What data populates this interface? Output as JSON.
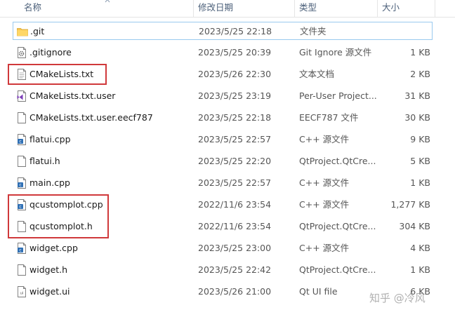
{
  "header": {
    "name": "名称",
    "date_modified": "修改日期",
    "type": "类型",
    "size": "大小"
  },
  "files": [
    {
      "name": ".git",
      "date": "2023/5/25 22:18",
      "type": "文件夹",
      "size": "",
      "icon": "folder-icon"
    },
    {
      "name": ".gitignore",
      "date": "2023/5/25 20:39",
      "type": "Git Ignore 源文件",
      "size": "1 KB",
      "icon": "gear-file-icon"
    },
    {
      "name": "CMakeLists.txt",
      "date": "2023/5/26 22:30",
      "type": "文本文档",
      "size": "2 KB",
      "icon": "text-file-icon"
    },
    {
      "name": "CMakeLists.txt.user",
      "date": "2023/5/25 23:19",
      "type": "Per-User Project...",
      "size": "31 KB",
      "icon": "visual-studio-file-icon"
    },
    {
      "name": "CMakeLists.txt.user.eecf787",
      "date": "2023/5/25 22:18",
      "type": "EECF787 文件",
      "size": "30 KB",
      "icon": "blank-file-icon"
    },
    {
      "name": "flatui.cpp",
      "date": "2023/5/25 22:57",
      "type": "C++ 源文件",
      "size": "9 KB",
      "icon": "cpp-file-icon"
    },
    {
      "name": "flatui.h",
      "date": "2023/5/25 22:20",
      "type": "QtProject.QtCre...",
      "size": "5 KB",
      "icon": "blank-file-icon"
    },
    {
      "name": "main.cpp",
      "date": "2023/5/25 22:57",
      "type": "C++ 源文件",
      "size": "1 KB",
      "icon": "cpp-file-icon"
    },
    {
      "name": "qcustomplot.cpp",
      "date": "2022/11/6 23:54",
      "type": "C++ 源文件",
      "size": "1,277 KB",
      "icon": "cpp-file-icon"
    },
    {
      "name": "qcustomplot.h",
      "date": "2022/11/6 23:54",
      "type": "QtProject.QtCre...",
      "size": "304 KB",
      "icon": "blank-file-icon"
    },
    {
      "name": "widget.cpp",
      "date": "2023/5/25 23:00",
      "type": "C++ 源文件",
      "size": "4 KB",
      "icon": "cpp-file-icon"
    },
    {
      "name": "widget.h",
      "date": "2023/5/25 22:42",
      "type": "QtProject.QtCre...",
      "size": "1 KB",
      "icon": "blank-file-icon"
    },
    {
      "name": "widget.ui",
      "date": "2023/5/26 21:00",
      "type": "Qt UI file",
      "size": "6 KB",
      "icon": "ui-file-icon"
    }
  ],
  "watermark": "知乎 @冷风",
  "colors": {
    "highlight_box": "#d0393b",
    "selection_border": "#99c9ef",
    "folder": "#f5c451",
    "cpp_badge": "#2f6fb4"
  }
}
